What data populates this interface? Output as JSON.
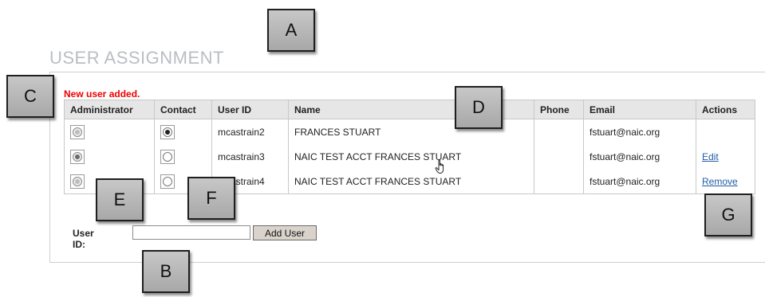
{
  "page_title": "USER ASSIGNMENT",
  "status_message": "New user added.",
  "table": {
    "headers": {
      "administrator": "Administrator",
      "contact": "Contact",
      "user_id": "User ID",
      "name": "Name",
      "phone": "Phone",
      "email": "Email",
      "actions": "Actions"
    },
    "rows": [
      {
        "user_id": "mcastrain2",
        "name": "FRANCES STUART",
        "phone": "",
        "email": "fstuart@naic.org",
        "action": "",
        "administrator": false,
        "contact": true
      },
      {
        "user_id": "mcastrain3",
        "name": "NAIC TEST ACCT FRANCES STUART",
        "phone": "",
        "email": "fstuart@naic.org",
        "action": "Edit",
        "administrator": true,
        "contact": false
      },
      {
        "user_id": "mcastrain4",
        "name": "NAIC TEST ACCT FRANCES STUART",
        "phone": "",
        "email": "fstuart@naic.org",
        "action": "Remove",
        "administrator": false,
        "contact": false
      }
    ]
  },
  "add_user": {
    "label": "User ID:",
    "input_value": "",
    "button_label": "Add User"
  },
  "callouts": {
    "a": "A",
    "b": "B",
    "c": "C",
    "d": "D",
    "e": "E",
    "f": "F",
    "g": "G"
  }
}
